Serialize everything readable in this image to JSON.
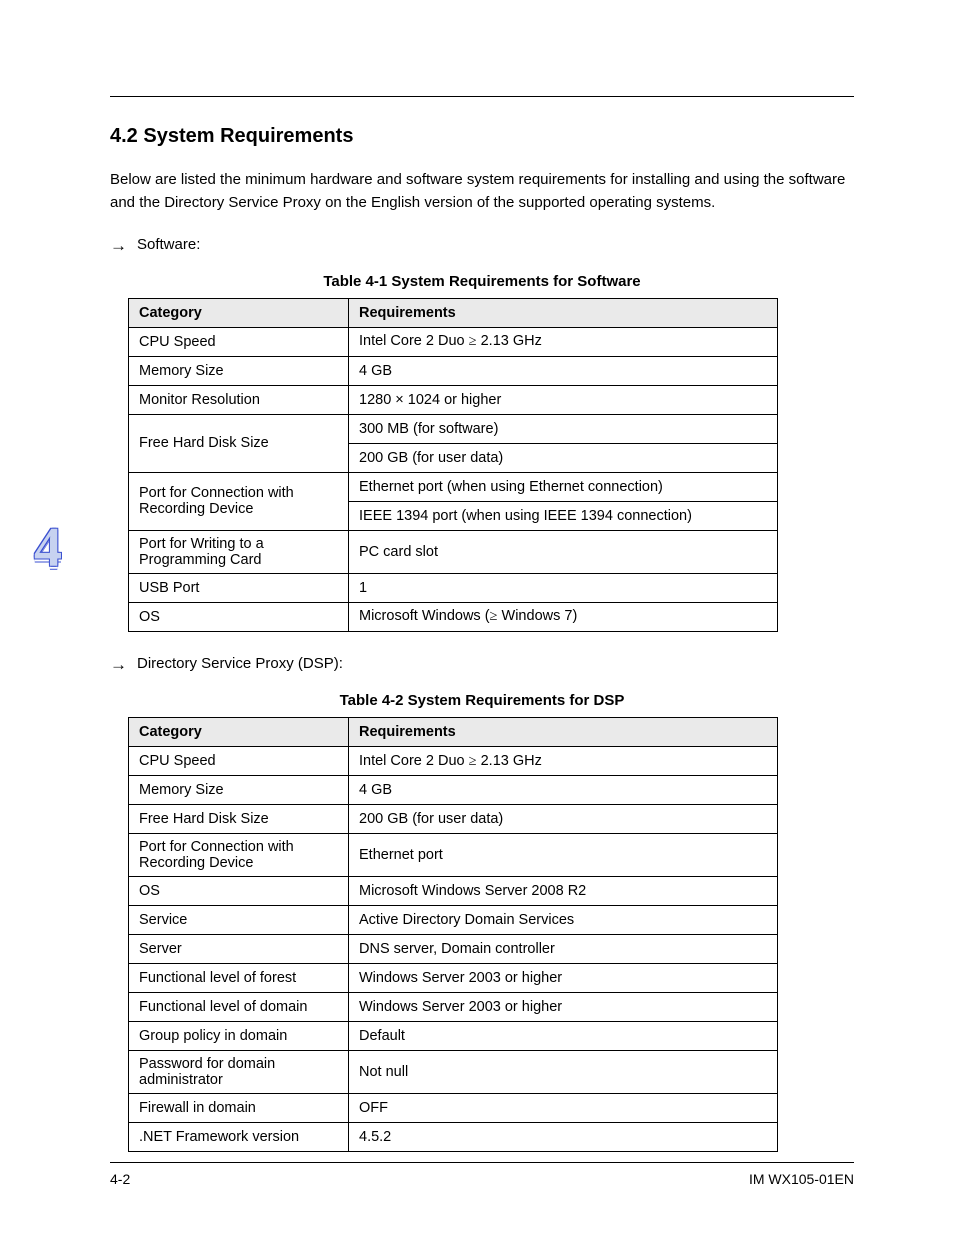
{
  "header": {
    "chapter_number": "4"
  },
  "section": {
    "title": "4.2 System Requirements",
    "intro": "Below are listed the minimum hardware and software system requirements for installing and using the software and the Directory Service Proxy on the English version of the supported operating systems.",
    "bullet_software": "Software:",
    "bullet_dsp": "Directory Service Proxy (DSP):"
  },
  "table1": {
    "caption": "Table 4-1 System Requirements for Software",
    "h1": "Category",
    "h2": "Requirements",
    "rows": [
      {
        "c": "CPU Speed",
        "r": "Intel Core 2 Duo ≥ 2.13 GHz"
      },
      {
        "c": "Memory Size",
        "r": "4 GB"
      },
      {
        "c": "Monitor Resolution",
        "r": "1280 × 1024 or higher"
      },
      {
        "c": "Free Hard Disk Size",
        "r": "300 MB (for software)",
        "rowspan": 2
      },
      {
        "c": null,
        "r": "200 GB (for user data)"
      },
      {
        "c": "Port for Connection with Recording Device",
        "rowspan": 2,
        "r": "Ethernet port (when using Ethernet connection)"
      },
      {
        "c": null,
        "r": "IEEE 1394 port (when using IEEE 1394 connection)"
      },
      {
        "c": "Port for Writing to a Programming Card",
        "r": "PC card slot"
      },
      {
        "c": "USB Port",
        "r": "1"
      },
      {
        "c": "OS",
        "r": "Microsoft Windows (≥ Windows 7)"
      }
    ]
  },
  "table2": {
    "caption": "Table 4-2 System Requirements for DSP",
    "h1": "Category",
    "h2": "Requirements",
    "rows": [
      {
        "c": "CPU Speed",
        "r": "Intel Core 2 Duo ≥ 2.13 GHz"
      },
      {
        "c": "Memory Size",
        "r": "4 GB"
      },
      {
        "c": "Free Hard Disk Size",
        "r": "200 GB (for user data)"
      },
      {
        "c": "Port for Connection with Recording Device",
        "r": "Ethernet port"
      },
      {
        "c": "OS",
        "r": "Microsoft Windows Server 2008 R2"
      },
      {
        "c": "Service",
        "r": "Active Directory Domain Services"
      },
      {
        "c": "Server",
        "r": "DNS server, Domain controller"
      },
      {
        "c": "Functional level of forest",
        "r": "Windows Server 2003 or higher"
      },
      {
        "c": "Functional level of domain",
        "r": "Windows Server 2003 or higher"
      },
      {
        "c": "Group policy in domain",
        "r": "Default"
      },
      {
        "c": "Password for domain administrator",
        "r": "Not null"
      },
      {
        "c": "Firewall in domain",
        "r": "OFF"
      },
      {
        "c": ".NET Framework version",
        "r": "4.5.2"
      }
    ]
  },
  "footer": {
    "left": "4-2",
    "right": "IM WX105-01EN"
  }
}
